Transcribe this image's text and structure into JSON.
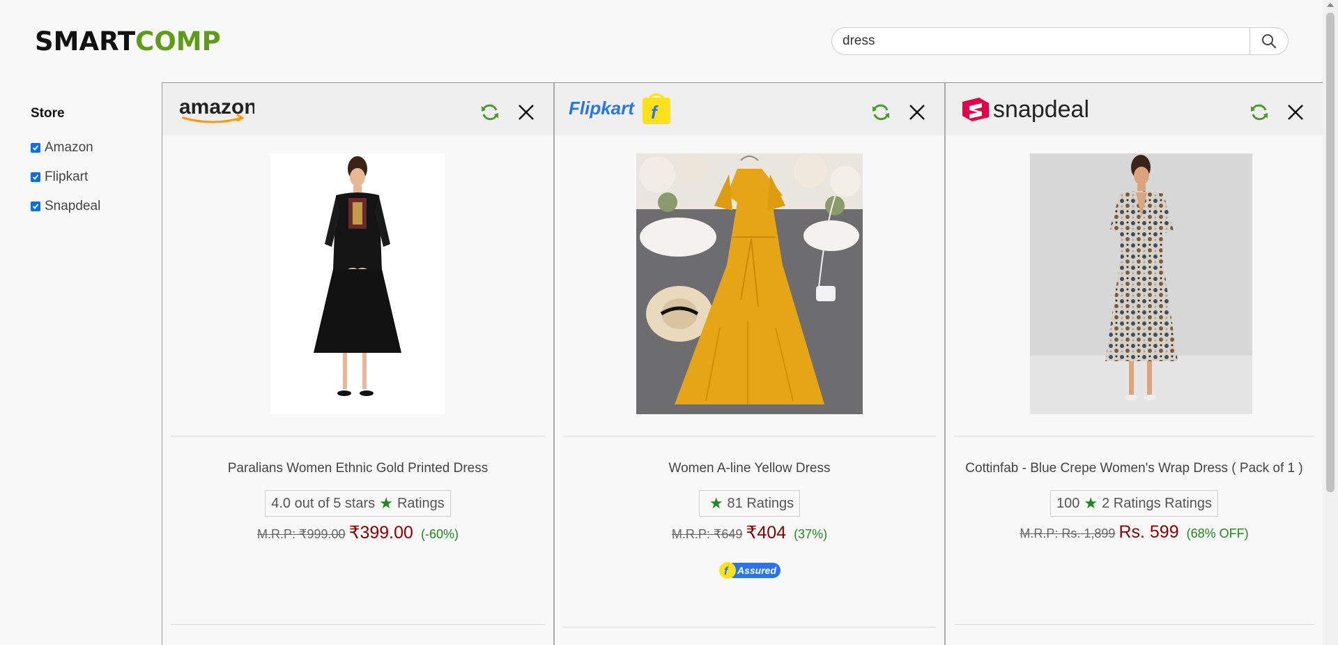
{
  "header": {
    "logo_smart": "SMART",
    "logo_comp": "COMP",
    "search_value": "dress"
  },
  "sidebar": {
    "title": "Store",
    "options": [
      {
        "label": "Amazon",
        "checked": true
      },
      {
        "label": "Flipkart",
        "checked": true
      },
      {
        "label": "Snapdeal",
        "checked": true
      }
    ]
  },
  "panels": [
    {
      "store": "amazon",
      "brand_text": "amazon",
      "product_name": "Paralians Women Ethnic Gold Printed Dress",
      "rating_left": "4.0 out of 5 stars",
      "rating_right": "Ratings",
      "mrp": "M.R.P: ₹999.00",
      "price": "₹399.00",
      "discount": "(-60%)"
    },
    {
      "store": "flipkart",
      "brand_text": "Flipkart",
      "product_name": "Women A-line Yellow Dress",
      "rating_left": "",
      "rating_right": "81 Ratings",
      "mrp": "M.R.P: ₹649",
      "price": "₹404",
      "discount": "(37%)",
      "badge": "Assured"
    },
    {
      "store": "snapdeal",
      "brand_text": "snapdeal",
      "product_name": "Cottinfab - Blue Crepe Women's Wrap Dress ( Pack of 1 )",
      "rating_left": "100",
      "rating_right": "2 Ratings Ratings",
      "mrp": "M.R.P: Rs. 1,899",
      "price": "Rs. 599",
      "discount": "(68% OFF)"
    }
  ],
  "colors": {
    "brand_green": "#5e9c17",
    "price_red": "#8b0000",
    "discount_green": "#1b8a1b",
    "checkbox_blue": "#0b6fe0",
    "flipkart_blue": "#2874f0",
    "flipkart_yellow": "#ffe11b",
    "snapdeal_red": "#e40046"
  }
}
